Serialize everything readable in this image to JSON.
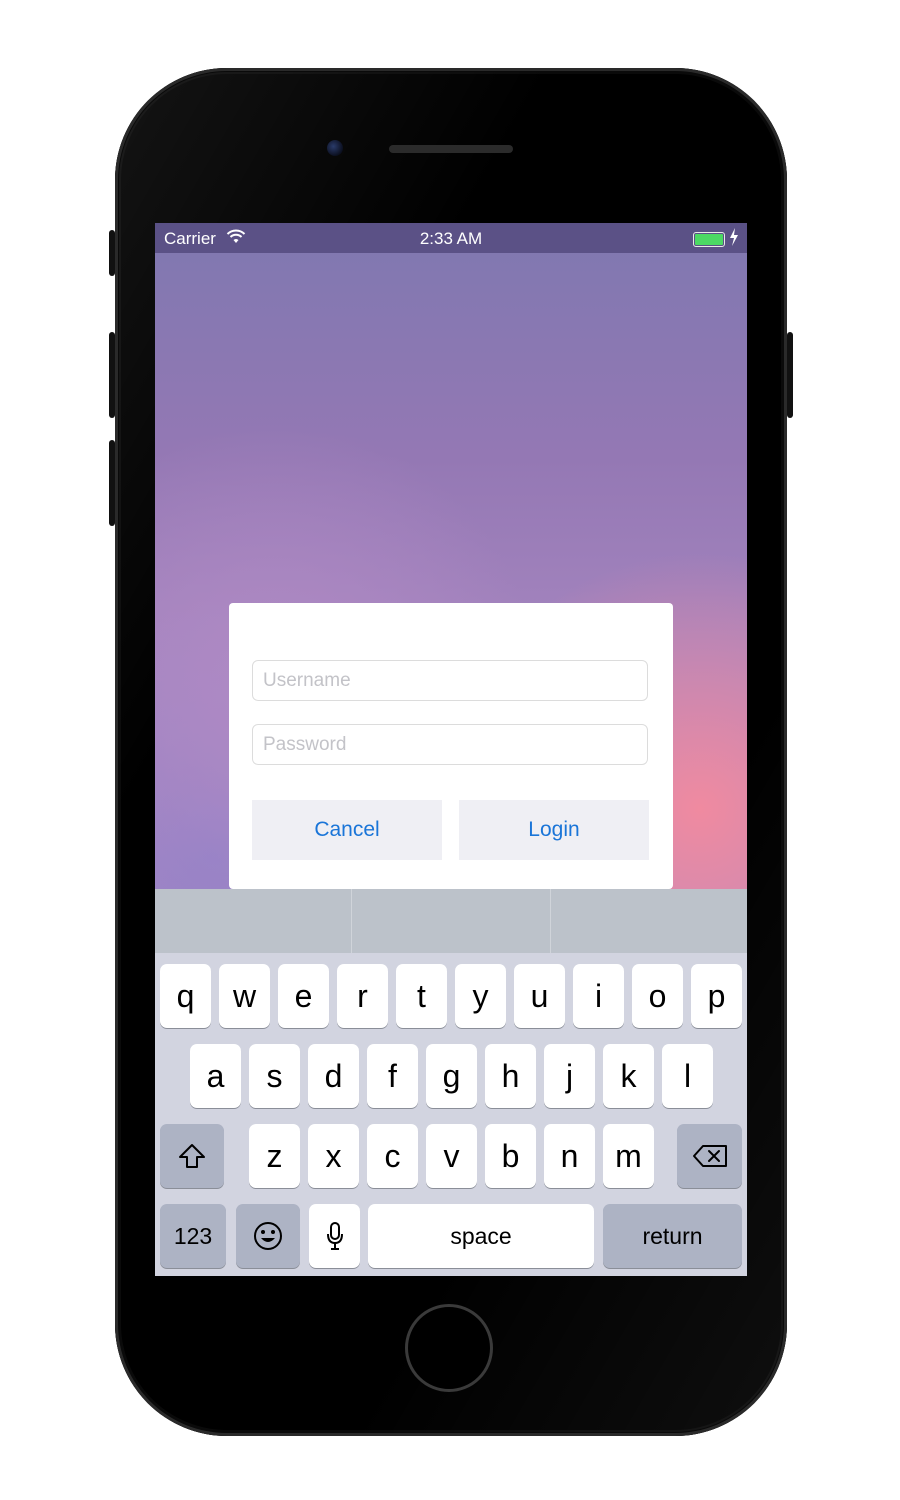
{
  "status_bar": {
    "carrier": "Carrier",
    "time": "2:33 AM"
  },
  "dialog": {
    "username_placeholder": "Username",
    "password_placeholder": "Password",
    "cancel_label": "Cancel",
    "login_label": "Login"
  },
  "keyboard": {
    "row1": [
      "q",
      "w",
      "e",
      "r",
      "t",
      "y",
      "u",
      "i",
      "o",
      "p"
    ],
    "row2": [
      "a",
      "s",
      "d",
      "f",
      "g",
      "h",
      "j",
      "k",
      "l"
    ],
    "row3": [
      "z",
      "x",
      "c",
      "v",
      "b",
      "n",
      "m"
    ],
    "numbers_label": "123",
    "space_label": "space",
    "return_label": "return",
    "icons": [
      "shift-icon",
      "backspace-icon",
      "emoji-icon",
      "microphone-icon"
    ]
  },
  "colors": {
    "accent": "#1a75d8",
    "battery": "#4cd964",
    "key_dark": "#adb3c4"
  }
}
